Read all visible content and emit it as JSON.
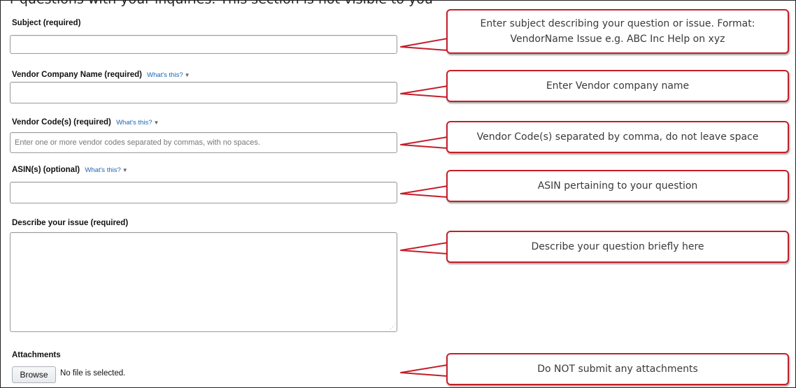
{
  "page": {
    "top_partial_text": "r questions with your inquiries. This section is not visible to you"
  },
  "form": {
    "subject": {
      "label": "Subject (required)",
      "value": ""
    },
    "vendor_company": {
      "label": "Vendor Company Name (required)",
      "whats_this": "What's this?",
      "value": ""
    },
    "vendor_codes": {
      "label": "Vendor Code(s) (required)",
      "whats_this": "What's this?",
      "placeholder": "Enter one or more vendor codes separated by commas, with no spaces.",
      "value": ""
    },
    "asins": {
      "label": "ASIN(s) (optional)",
      "whats_this": "What's this?",
      "value": ""
    },
    "describe": {
      "label": "Describe your issue (required)",
      "value": ""
    },
    "attachments": {
      "label": "Attachments",
      "browse_label": "Browse",
      "status": "No file is selected."
    }
  },
  "callouts": {
    "subject_line1": "Enter subject describing your question or issue. Format:",
    "subject_line2": "VendorName Issue e.g. ABC Inc Help on xyz",
    "vendor_company": "Enter Vendor company name",
    "vendor_codes": "Vendor Code(s) separated by comma, do not leave space",
    "asins": "ASIN pertaining to your question",
    "describe": "Describe your question briefly here",
    "attachments": "Do NOT submit any attachments"
  },
  "colors": {
    "callout_border": "#c41e2a",
    "link": "#1b65b4"
  }
}
